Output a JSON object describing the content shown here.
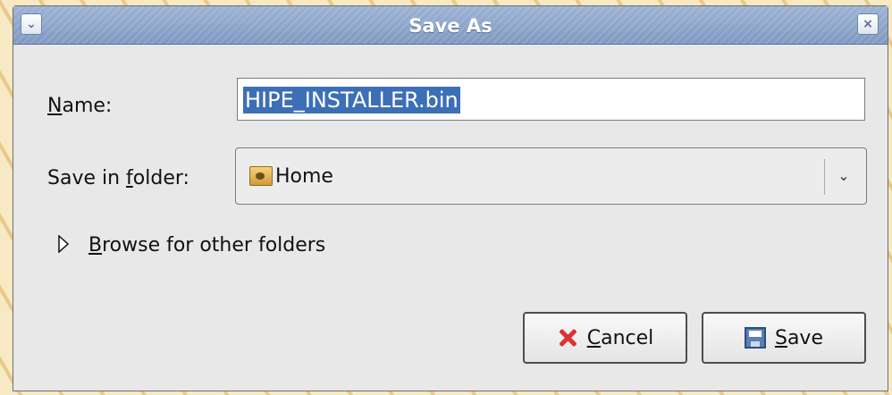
{
  "window": {
    "title": "Save As"
  },
  "fields": {
    "name_label_prefix": "N",
    "name_label_rest": "ame:",
    "name_value": "HIPE_INSTALLER.bin",
    "folder_label_prefix": "Save in ",
    "folder_label_mnemonic": "f",
    "folder_label_rest": "older:",
    "folder_value": "Home"
  },
  "browse": {
    "label_mnemonic": "B",
    "label_rest": "rowse for other folders"
  },
  "buttons": {
    "cancel_mnemonic": "C",
    "cancel_rest": "ancel",
    "save_mnemonic": "S",
    "save_rest": "ave"
  },
  "icons": {
    "window_menu": "chevron-down-icon",
    "close": "close-icon",
    "folder": "folder-icon",
    "expander": "triangle-right-icon",
    "cancel": "cancel-icon",
    "save": "save-icon"
  },
  "colors": {
    "title_bar": "#8ea7cd",
    "selection": "#3d6fb8",
    "cancel_icon": "#dd3333",
    "save_icon": "#5c7fb6"
  }
}
